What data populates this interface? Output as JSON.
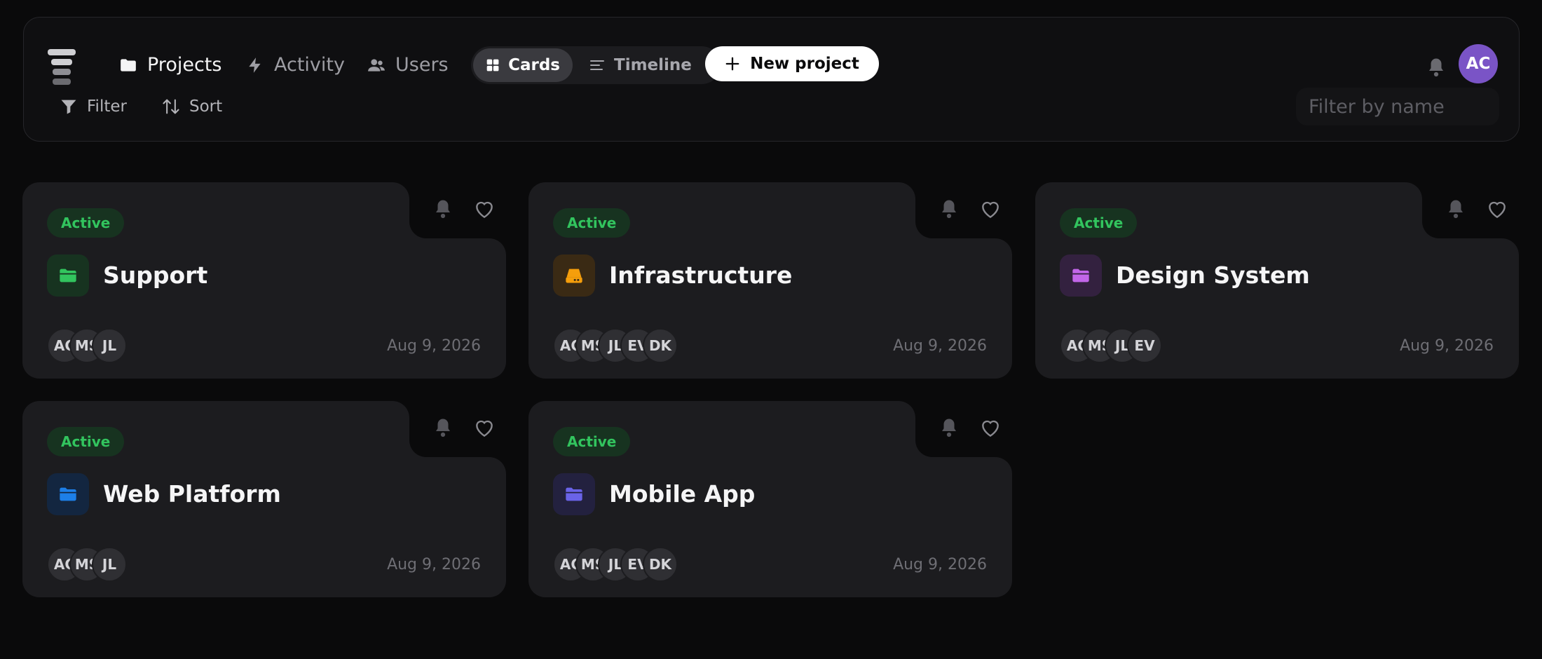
{
  "nav": {
    "projects": "Projects",
    "activity": "Activity",
    "users": "Users"
  },
  "view_toggle": {
    "cards": "Cards",
    "timeline": "Timeline",
    "selected": "Cards"
  },
  "new_project": "New project",
  "user_initials": "AC",
  "toolbar": {
    "filter": "Filter",
    "sort": "Sort",
    "search_placeholder": "Filter by name"
  },
  "colors": {
    "status_active": "#32c45e",
    "avatar": "#7a54c6"
  },
  "projects": [
    {
      "status": "Active",
      "name": "Support",
      "icon": "folder-icon",
      "icon_color": "#32c45e",
      "icon_bg": "#173320",
      "members": [
        "AC",
        "MS",
        "JL"
      ],
      "date": "Aug 9, 2026"
    },
    {
      "status": "Active",
      "name": "Infrastructure",
      "icon": "server-icon",
      "icon_color": "#f59e0b",
      "icon_bg": "#3a2a14",
      "members": [
        "AC",
        "MS",
        "JL",
        "EV",
        "DK"
      ],
      "date": "Aug 9, 2026"
    },
    {
      "status": "Active",
      "name": "Design System",
      "icon": "folder-icon",
      "icon_color": "#c266e8",
      "icon_bg": "#33213f",
      "members": [
        "AC",
        "MS",
        "JL",
        "EV"
      ],
      "date": "Aug 9, 2026"
    },
    {
      "status": "Active",
      "name": "Web Platform",
      "icon": "folder-icon",
      "icon_color": "#1d7fe8",
      "icon_bg": "#132640",
      "members": [
        "AC",
        "MS",
        "JL"
      ],
      "date": "Aug 9, 2026"
    },
    {
      "status": "Active",
      "name": "Mobile App",
      "icon": "folder-icon",
      "icon_color": "#6a63e8",
      "icon_bg": "#23213f",
      "members": [
        "AC",
        "MS",
        "JL",
        "EV",
        "DK"
      ],
      "date": "Aug 9, 2026"
    }
  ]
}
